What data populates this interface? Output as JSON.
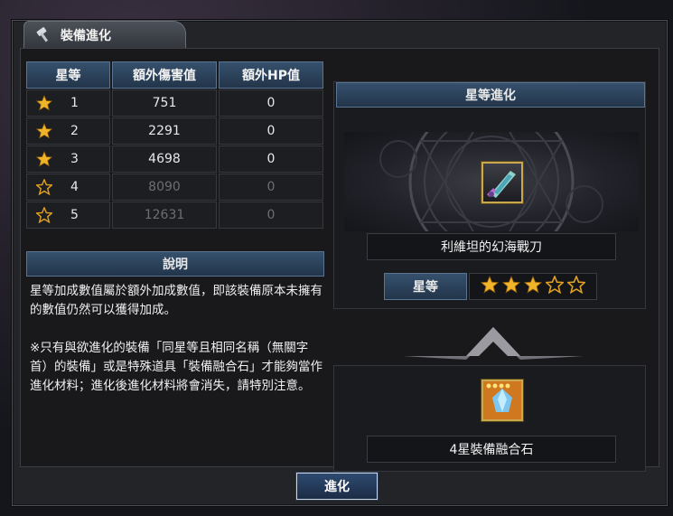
{
  "window": {
    "title": "裝備進化",
    "title_icon": "hammer-icon"
  },
  "star_table": {
    "headers": [
      "星等",
      "額外傷害值",
      "額外HP值"
    ],
    "rows": [
      {
        "level": "1",
        "damage": "751",
        "hp": "0",
        "filled": true
      },
      {
        "level": "2",
        "damage": "2291",
        "hp": "0",
        "filled": true
      },
      {
        "level": "3",
        "damage": "4698",
        "hp": "0",
        "filled": true
      },
      {
        "level": "4",
        "damage": "8090",
        "hp": "0",
        "filled": false
      },
      {
        "level": "5",
        "damage": "12631",
        "hp": "0",
        "filled": false
      }
    ]
  },
  "description": {
    "header": "說明",
    "text": "星等加成數值屬於額外加成數值，即該裝備原本未擁有的數值仍然可以獲得加成。\n\n※只有與欲進化的裝備「同星等且相同名稱（無關字首）的裝備」或是特殊道具「裝備融合石」才能夠當作進化材料；進化後進化材料將會消失，請特別注意。"
  },
  "evolution": {
    "header": "星等進化",
    "item_name": "利維坦的幻海戰刀",
    "grade_label": "星等",
    "current_stars": 3,
    "max_stars": 5,
    "material_name": "4星裝備融合石"
  },
  "actions": {
    "evolve_label": "進化"
  },
  "colors": {
    "star_gold": "#f0b428",
    "header_blue": "#2c4562",
    "slot_gold": "#c9a850"
  }
}
